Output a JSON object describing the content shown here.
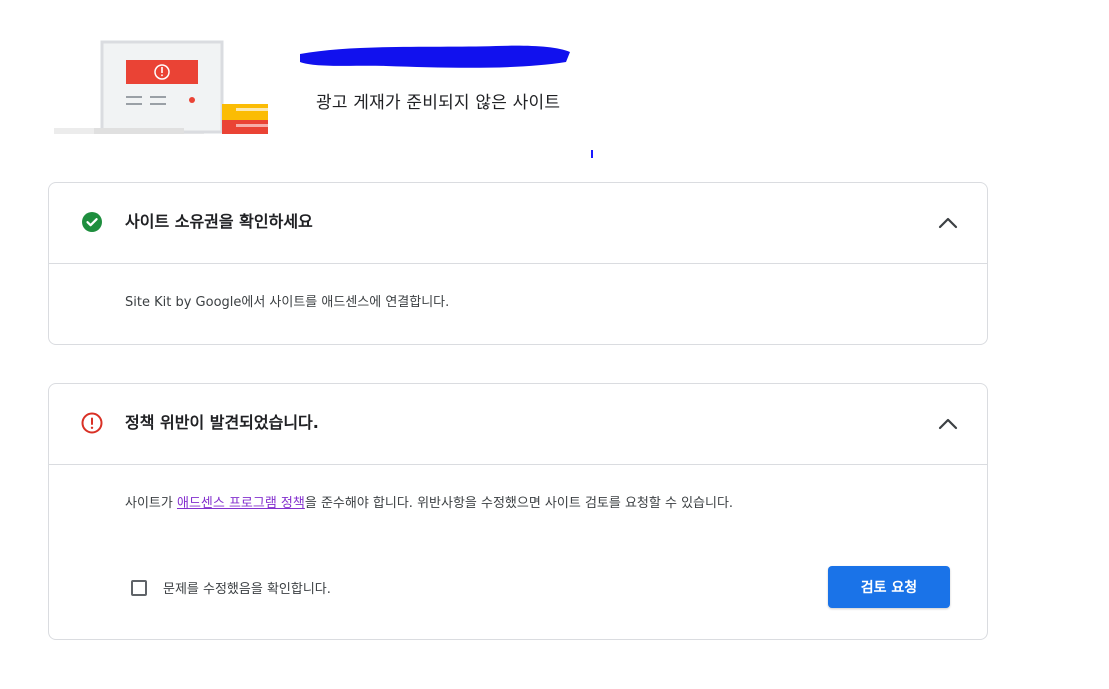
{
  "header": {
    "site_status": "광고 게재가 준비되지 않은 사이트"
  },
  "cards": [
    {
      "title": "사이트 소유권을 확인하세요",
      "status_icon": "check-circle-icon",
      "status_color": "#1e8e3e",
      "body": "Site Kit by Google에서 사이트를 애드센스에 연결합니다."
    },
    {
      "title": "정책 위반이 발견되었습니다.",
      "status_icon": "error-circle-icon",
      "status_color": "#d93025",
      "body_prefix": "사이트가 ",
      "body_link": "애드센스 프로그램 정책",
      "body_suffix": "을 준수해야 합니다. 위반사항을 수정했으면 사이트 검토를 요청할 수 있습니다.",
      "confirm_label": "문제를 수정했음을 확인합니다.",
      "review_button": "검토 요청"
    }
  ],
  "colors": {
    "accent": "#1a73e8",
    "link": "#8430ce",
    "border": "#dadce0"
  }
}
